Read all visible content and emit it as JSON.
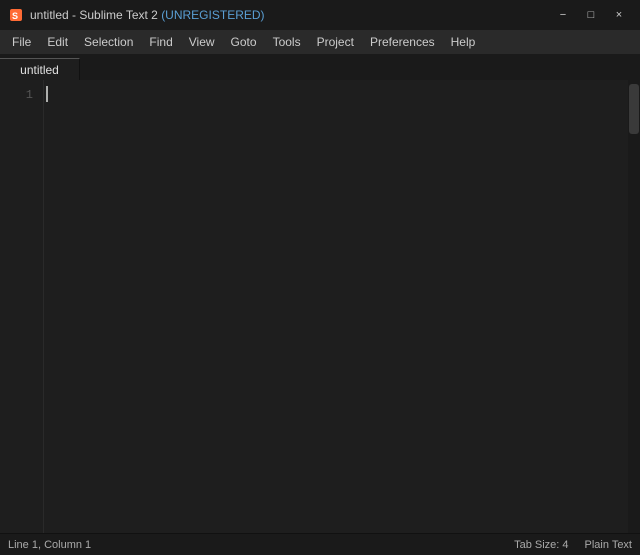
{
  "titlebar": {
    "title": "untitled - Sublime Text 2 ",
    "unregistered": "(UNREGISTERED)",
    "icon": "sublime-icon"
  },
  "window_controls": {
    "minimize": "−",
    "maximize": "□",
    "close": "×"
  },
  "menu": {
    "items": [
      "File",
      "Edit",
      "Selection",
      "Find",
      "View",
      "Goto",
      "Tools",
      "Project",
      "Preferences",
      "Help"
    ]
  },
  "tab": {
    "label": "untitled"
  },
  "gutter": {
    "line_numbers": [
      "1"
    ]
  },
  "statusbar": {
    "position": "Line 1, Column 1",
    "tab_size": "Tab Size: 4",
    "syntax": "Plain Text"
  }
}
